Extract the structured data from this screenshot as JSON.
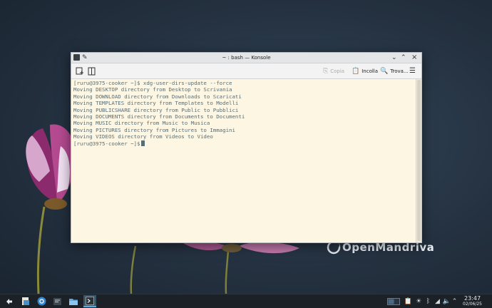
{
  "brand": {
    "logo_text": "OpenMandriva"
  },
  "window": {
    "title": "~ : bash — Konsole",
    "toolbar": {
      "copy_label": "Copia",
      "paste_label": "Incolla",
      "find_label": "Trova..."
    },
    "icons": [
      "konsole-app-icon",
      "pin-icon",
      "minimize-icon",
      "maximize-icon",
      "close-icon",
      "new-tab-icon",
      "split-view-icon",
      "copy-icon",
      "paste-icon",
      "search-icon",
      "hamburger-menu-icon"
    ]
  },
  "terminal": {
    "colors": {
      "background": "#fdf6e3",
      "text": "#586e75"
    },
    "lines": [
      "[ruru@3975-cooker ~]$ xdg-user-dirs-update --force",
      "Moving DESKTOP directory from Desktop to Scrivania",
      "Moving DOWNLOAD directory from Downloads to Scaricati",
      "Moving TEMPLATES directory from Templates to Modelli",
      "Moving PUBLICSHARE directory from Public to Pubblici",
      "Moving DOCUMENTS directory from Documents to Documenti",
      "Moving MUSIC directory from Music to Musica",
      "Moving PICTURES directory from Pictures to Immagini",
      "Moving VIDEOS directory from Videos to Video"
    ],
    "prompt": "[ruru@3975-cooker ~]$"
  },
  "taskbar": {
    "items": [
      "application-launcher-icon",
      "show-desktop-icon",
      "browser-icon",
      "system-settings-icon",
      "file-manager-icon",
      "konsole-task-icon"
    ],
    "tray": [
      "pager-icon",
      "clipboard-icon",
      "brightness-icon",
      "bluetooth-icon",
      "network-icon",
      "volume-icon",
      "expand-tray-icon"
    ],
    "clock": {
      "time": "23:47",
      "date": "02/06/25"
    }
  }
}
